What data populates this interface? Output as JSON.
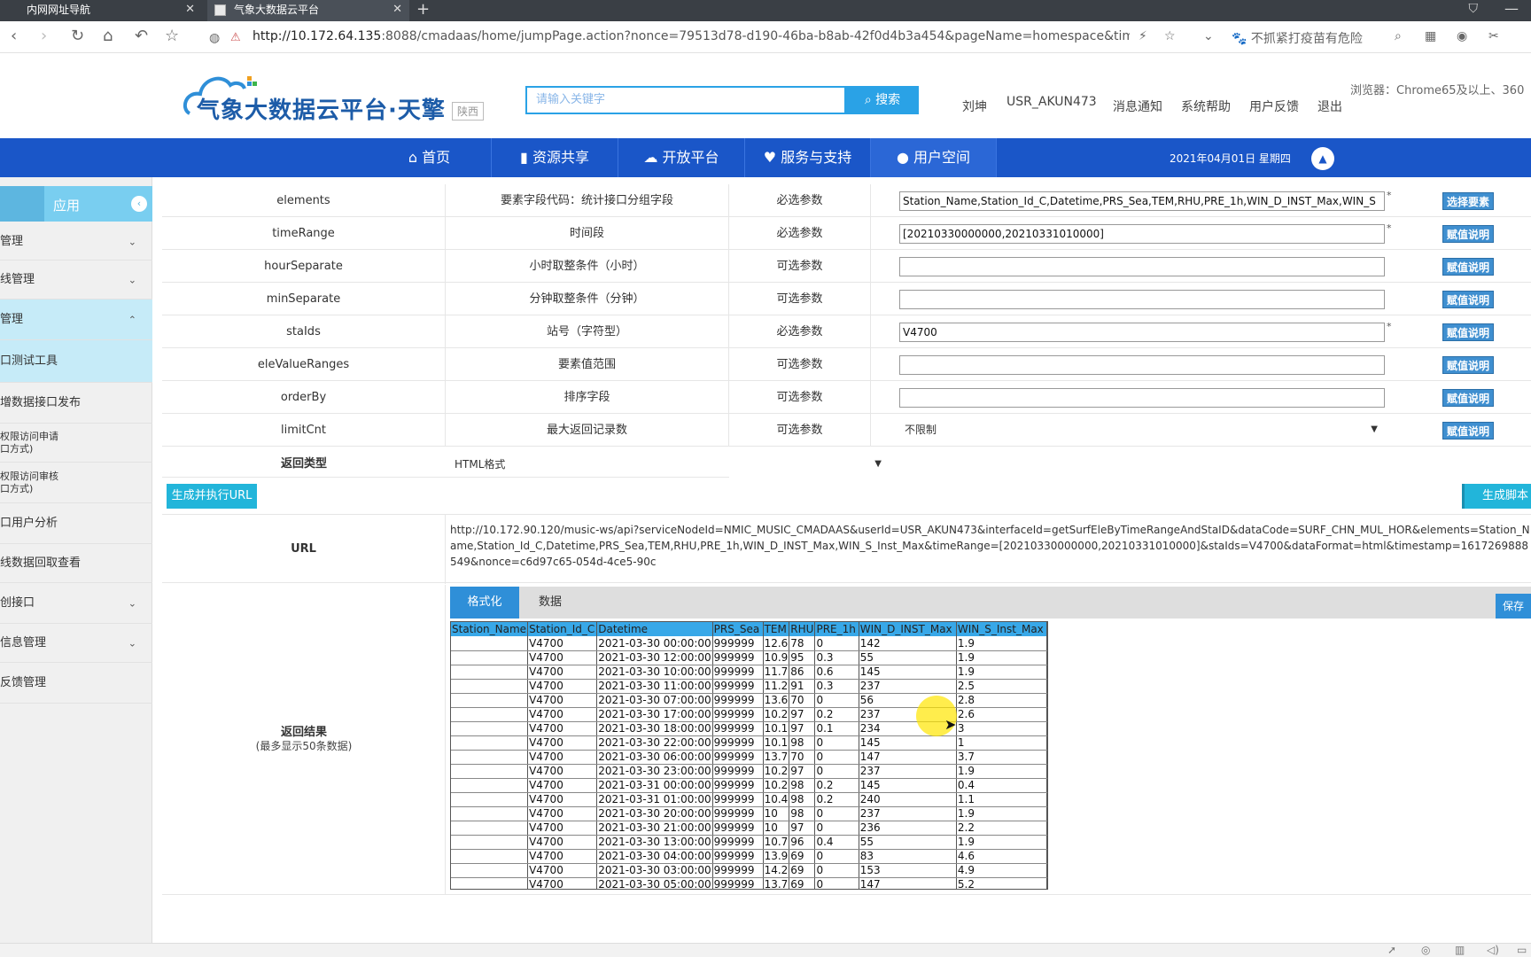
{
  "browser": {
    "tabs": [
      {
        "title": "内网网址导航"
      },
      {
        "title": "气象大数据云平台"
      }
    ],
    "url_prefix": "http://10.172.64.135",
    "url_rest": ":8088/cmadaas/home/jumpPage.action?nonce=79513d78-d190-46ba-b8ab-42f0d4b3a454&pageName=homespace&timestar",
    "warning": "不抓紧打疫苗有危险",
    "new_tab": "+"
  },
  "header": {
    "logo_text": "气象大数据云平台·天擎",
    "region": "陕西",
    "search_placeholder": "请输入关键字",
    "search_button": "搜索",
    "user_name": "刘坤",
    "user_id": "USR_AKUN473",
    "links": [
      "消息通知",
      "系统帮助",
      "用户反馈",
      "退出"
    ],
    "browser_note": "浏览器：Chrome65及以上、360"
  },
  "nav": {
    "items": [
      {
        "label": "首页",
        "icon": "home-icon"
      },
      {
        "label": "资源共享",
        "icon": "chart-icon"
      },
      {
        "label": "开放平台",
        "icon": "cloud-icon"
      },
      {
        "label": "服务与支持",
        "icon": "heart-icon"
      },
      {
        "label": "用户空间",
        "icon": "user-icon"
      }
    ],
    "date": "2021年04月01日 星期四"
  },
  "sidebar": {
    "title": "应用",
    "items": [
      {
        "label": "管理"
      },
      {
        "label": "线管理"
      },
      {
        "label": "管理"
      },
      {
        "label": "口测试工具"
      },
      {
        "label": "增数据接口发布"
      },
      {
        "label": "权限访问申请\n口方式)"
      },
      {
        "label": "权限访问审核\n口方式)"
      },
      {
        "label": "口用户分析"
      },
      {
        "label": "线数据回取查看"
      },
      {
        "label": "创接口"
      },
      {
        "label": "信息管理"
      },
      {
        "label": "反馈管理"
      }
    ]
  },
  "params": {
    "rows": [
      {
        "name": "elements",
        "desc": "要素字段代码：统计接口分组字段",
        "req": "必选参数",
        "value": "Station_Name,Station_Id_C,Datetime,PRS_Sea,TEM,RHU,PRE_1h,WIN_D_INST_Max,WIN_S",
        "btn": "选择要素"
      },
      {
        "name": "timeRange",
        "desc": "时间段",
        "req": "必选参数",
        "value": "[20210330000000,20210331010000]",
        "btn": "赋值说明"
      },
      {
        "name": "hourSeparate",
        "desc": "小时取整条件（小时）",
        "req": "可选参数",
        "value": "",
        "btn": "赋值说明"
      },
      {
        "name": "minSeparate",
        "desc": "分钟取整条件（分钟）",
        "req": "可选参数",
        "value": "",
        "btn": "赋值说明"
      },
      {
        "name": "staIds",
        "desc": "站号（字符型）",
        "req": "必选参数",
        "value": "V4700",
        "btn": "赋值说明"
      },
      {
        "name": "eleValueRanges",
        "desc": "要素值范围",
        "req": "可选参数",
        "value": "",
        "btn": "赋值说明"
      },
      {
        "name": "orderBy",
        "desc": "排序字段",
        "req": "可选参数",
        "value": "",
        "btn": "赋值说明"
      },
      {
        "name": "limitCnt",
        "desc": "最大返回记录数",
        "req": "可选参数",
        "value": "不限制",
        "btn": "赋值说明"
      }
    ],
    "required_mark": "*",
    "return_type_label": "返回类型",
    "return_type_value": "HTML格式"
  },
  "actions": {
    "generate_exec": "生成并执行URL",
    "generate_script": "生成脚本"
  },
  "url_section": {
    "label": "URL",
    "text": "http://10.172.90.120/music-ws/api?serviceNodeId=NMIC_MUSIC_CMADAAS&userId=USR_AKUN473&interfaceId=getSurfEleByTimeRangeAndStaID&dataCode=SURF_CHN_MUL_HOR&elements=Station_Name,Station_Id_C,Datetime,PRS_Sea,TEM,RHU,PRE_1h,WIN_D_INST_Max,WIN_S_Inst_Max&timeRange=[20210330000000,20210331010000]&staIds=V4700&dataFormat=html&timestamp=1617269888549&nonce=c6d97c65-054d-4ce5-90c"
  },
  "result": {
    "label": "返回结果",
    "note": "(最多显示50条数据)",
    "tabs": [
      "格式化",
      "数据"
    ],
    "save_button": "保存文",
    "columns": [
      "Station_Name",
      "Station_Id_C",
      "Datetime",
      "PRS_Sea",
      "TEM",
      "RHU",
      "PRE_1h",
      "WIN_D_INST_Max",
      "WIN_S_Inst_Max"
    ],
    "rows": [
      [
        "",
        "V4700",
        "2021-03-30 00:00:00",
        "999999",
        "12.6",
        "78",
        "0",
        "142",
        "1.9"
      ],
      [
        "",
        "V4700",
        "2021-03-30 12:00:00",
        "999999",
        "10.9",
        "95",
        "0.3",
        "55",
        "1.9"
      ],
      [
        "",
        "V4700",
        "2021-03-30 10:00:00",
        "999999",
        "11.7",
        "86",
        "0.6",
        "145",
        "1.9"
      ],
      [
        "",
        "V4700",
        "2021-03-30 11:00:00",
        "999999",
        "11.2",
        "91",
        "0.3",
        "237",
        "2.5"
      ],
      [
        "",
        "V4700",
        "2021-03-30 07:00:00",
        "999999",
        "13.6",
        "70",
        "0",
        "56",
        "2.8"
      ],
      [
        "",
        "V4700",
        "2021-03-30 17:00:00",
        "999999",
        "10.2",
        "97",
        "0.2",
        "237",
        "2.6"
      ],
      [
        "",
        "V4700",
        "2021-03-30 18:00:00",
        "999999",
        "10.1",
        "97",
        "0.1",
        "234",
        "3"
      ],
      [
        "",
        "V4700",
        "2021-03-30 22:00:00",
        "999999",
        "10.1",
        "98",
        "0",
        "145",
        "1"
      ],
      [
        "",
        "V4700",
        "2021-03-30 06:00:00",
        "999999",
        "13.7",
        "70",
        "0",
        "147",
        "3.7"
      ],
      [
        "",
        "V4700",
        "2021-03-30 23:00:00",
        "999999",
        "10.2",
        "97",
        "0",
        "237",
        "1.9"
      ],
      [
        "",
        "V4700",
        "2021-03-31 00:00:00",
        "999999",
        "10.2",
        "98",
        "0.2",
        "145",
        "0.4"
      ],
      [
        "",
        "V4700",
        "2021-03-31 01:00:00",
        "999999",
        "10.4",
        "98",
        "0.2",
        "240",
        "1.1"
      ],
      [
        "",
        "V4700",
        "2021-03-30 20:00:00",
        "999999",
        "10",
        "98",
        "0",
        "237",
        "1.9"
      ],
      [
        "",
        "V4700",
        "2021-03-30 21:00:00",
        "999999",
        "10",
        "97",
        "0",
        "236",
        "2.2"
      ],
      [
        "",
        "V4700",
        "2021-03-30 13:00:00",
        "999999",
        "10.7",
        "96",
        "0.4",
        "55",
        "1.9"
      ],
      [
        "",
        "V4700",
        "2021-03-30 04:00:00",
        "999999",
        "13.9",
        "69",
        "0",
        "83",
        "4.6"
      ],
      [
        "",
        "V4700",
        "2021-03-30 03:00:00",
        "999999",
        "14.2",
        "69",
        "0",
        "153",
        "4.9"
      ],
      [
        "",
        "V4700",
        "2021-03-30 05:00:00",
        "999999",
        "13.7",
        "69",
        "0",
        "147",
        "5.2"
      ]
    ]
  },
  "colors": {
    "nav_blue": "#1a56c8",
    "accent_cyan": "#22b5da",
    "header_cell": "#38a8e8"
  }
}
